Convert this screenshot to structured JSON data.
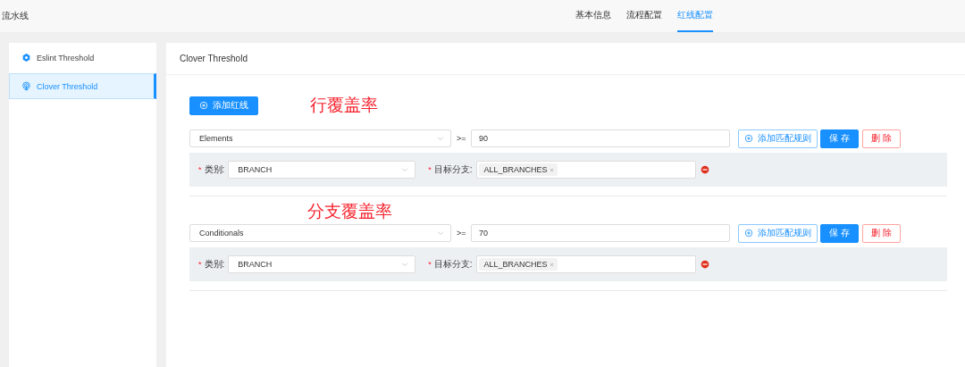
{
  "header": {
    "title": "流水线",
    "tabs": [
      {
        "label": "基本信息",
        "selected": false
      },
      {
        "label": "流程配置",
        "selected": false
      },
      {
        "label": "红线配置",
        "selected": true
      }
    ]
  },
  "sidebar": {
    "items": [
      {
        "label": "Eslint Threshold",
        "kind": "hexagon",
        "selected": false
      },
      {
        "label": "Clover Threshold",
        "kind": "radar",
        "selected": true
      }
    ]
  },
  "panel": {
    "title": "Clover Threshold",
    "add_button": "添加红线",
    "thresholds": [
      {
        "annotation": "行覆盖率",
        "metric": "Elements",
        "operator": ">=",
        "value": "90",
        "add_rule_button": "添加匹配规则",
        "save_button": "保 存",
        "delete_button": "删 除",
        "rules": [
          {
            "category_mark": "*",
            "category_label": "类别:",
            "category": "BRANCH",
            "branch_mark": "*",
            "branch_label": "目标分支:",
            "branches": [
              "ALL_BRANCHES"
            ]
          }
        ]
      },
      {
        "annotation": "分支覆盖率",
        "metric": "Conditionals",
        "operator": ">=",
        "value": "70",
        "add_rule_button": "添加匹配规则",
        "save_button": "保 存",
        "delete_button": "删 除",
        "rules": [
          {
            "category_mark": "*",
            "category_label": "类别:",
            "category": "BRANCH",
            "branch_mark": "*",
            "branch_label": "目标分支:",
            "branches": [
              "ALL_BRANCHES"
            ]
          }
        ]
      }
    ]
  }
}
